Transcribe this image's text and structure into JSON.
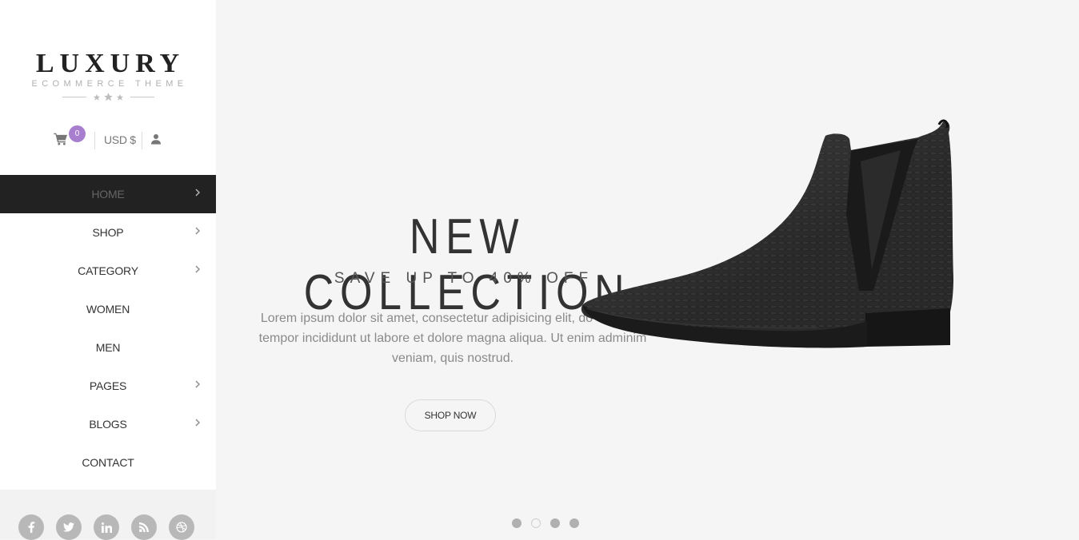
{
  "brand": {
    "title": "LUXURY",
    "subtitle": "ECOMMERCE THEME"
  },
  "utility": {
    "cart_count": "0",
    "currency": "USD $"
  },
  "nav": {
    "items": [
      {
        "label": "HOME",
        "active": true,
        "has_submenu": true
      },
      {
        "label": "SHOP",
        "active": false,
        "has_submenu": true
      },
      {
        "label": "CATEGORY",
        "active": false,
        "has_submenu": true
      },
      {
        "label": "WOMEN",
        "active": false,
        "has_submenu": false
      },
      {
        "label": "MEN",
        "active": false,
        "has_submenu": false
      },
      {
        "label": "PAGES",
        "active": false,
        "has_submenu": true
      },
      {
        "label": "BLOGS",
        "active": false,
        "has_submenu": true
      },
      {
        "label": "CONTACT",
        "active": false,
        "has_submenu": false
      }
    ]
  },
  "social": [
    "facebook-icon",
    "twitter-icon",
    "linkedin-icon",
    "rss-icon",
    "dribbble-icon"
  ],
  "hero": {
    "title": "NEW COLLECTION",
    "subtitle": "SAVE UP TO 40% OFF",
    "text": "Lorem ipsum dolor sit amet, consectetur adipisicing elit, do eiusmod tempor incididunt ut labore et dolore magna aliqua. Ut enim adminim veniam, quis nostrud.",
    "button": "SHOP NOW"
  },
  "slider": {
    "dots": 4,
    "active_index": 1
  },
  "colors": {
    "accent": "#a87fcf",
    "nav_active_bg": "#222222",
    "page_bg": "#f5f5f5"
  }
}
